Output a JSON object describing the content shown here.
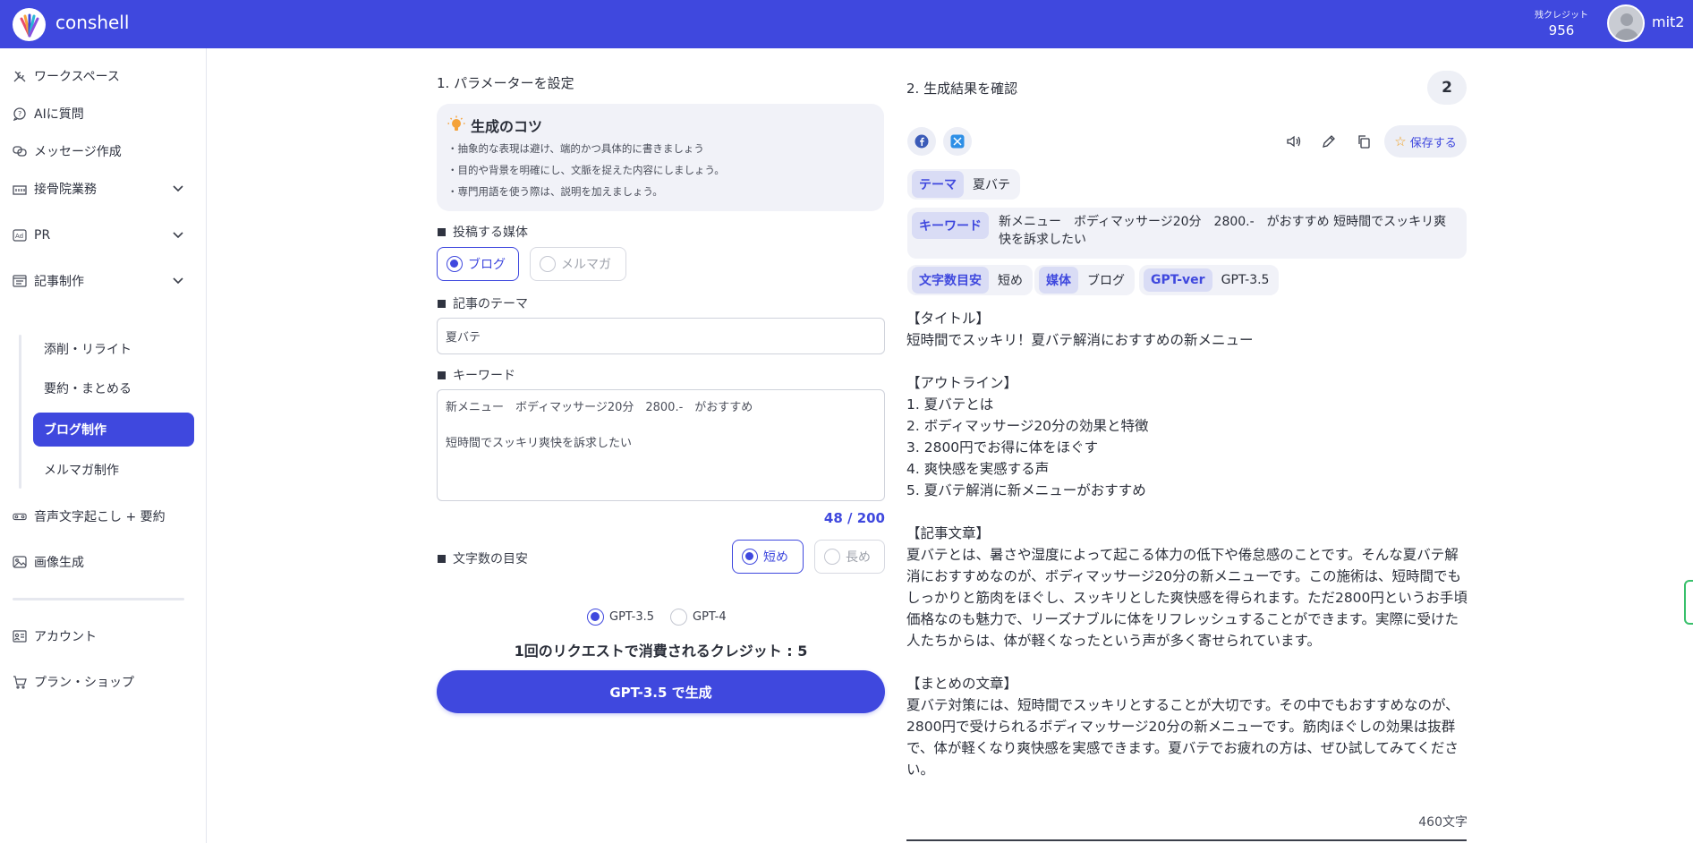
{
  "header": {
    "brand": "conshell",
    "credits_label": "残クレジット",
    "credits_value": "956",
    "username": "mit2"
  },
  "sidebar": {
    "items": [
      {
        "label": "ワークスペース",
        "icon": "tools-icon"
      },
      {
        "label": "AIに質問",
        "icon": "chat-question-icon"
      },
      {
        "label": "メッセージ作成",
        "icon": "chat-bubbles-icon"
      },
      {
        "label": "接骨院業務",
        "icon": "building-icon"
      },
      {
        "label": "PR",
        "icon": "ad-icon"
      },
      {
        "label": "記事制作",
        "icon": "article-icon"
      },
      {
        "label": "音声文字起こし + 要約",
        "icon": "audio-icon"
      },
      {
        "label": "画像生成",
        "icon": "image-icon"
      },
      {
        "label": "アカウント",
        "icon": "id-card-icon"
      },
      {
        "label": "プラン・ショップ",
        "icon": "cart-icon"
      }
    ],
    "sub_items": [
      "添削・リライト",
      "要約・まとめる",
      "ブログ制作",
      "メルマガ制作"
    ],
    "active_sub": "ブログ制作"
  },
  "params": {
    "title": "1. パラメーターを設定",
    "tips_title": "生成のコツ",
    "tips": [
      "・抽象的な表現は避け、端的かつ具体的に書きましょう",
      "・目的や背景を明確にし、文脈を捉えた内容にしましょう。",
      "・専門用語を使う際は、説明を加えましょう。"
    ],
    "media_label": "投稿する媒体",
    "media_options": [
      "ブログ",
      "メルマガ"
    ],
    "media_selected": "ブログ",
    "theme_label": "記事のテーマ",
    "theme_value": "夏バテ",
    "keyword_label": "キーワード",
    "keyword_value": "新メニュー　ボディマッサージ20分　2800.-　がおすすめ\n\n短時間でスッキリ爽快を訴求したい",
    "keyword_counter": "48 / 200",
    "length_label": "文字数の目安",
    "length_options": [
      "短め",
      "長め"
    ],
    "length_selected": "短め",
    "gpt_options": [
      "GPT-3.5",
      "GPT-4"
    ],
    "gpt_selected": "GPT-3.5",
    "credit_note": "1回のリクエストで消費されるクレジット : 5",
    "generate_label": "GPT-3.5 で生成"
  },
  "result": {
    "title": "2. 生成結果を確認",
    "count": "2",
    "save_label": "保存する",
    "chips": {
      "theme_tag": "テーマ",
      "theme_val": "夏バテ",
      "keyword_tag": "キーワード",
      "keyword_val": "新メニュー　ボディマッサージ20分　2800.-　がおすすめ 短時間でスッキリ爽快を訴求したい",
      "length_tag": "文字数目安",
      "length_val": "短め",
      "media_tag": "媒体",
      "media_val": "ブログ",
      "gpt_tag": "GPT-ver",
      "gpt_val": "GPT-3.5"
    },
    "body": "【タイトル】\n短時間でスッキリ！夏バテ解消におすすめの新メニュー\n\n【アウトライン】\n1. 夏バテとは\n2. ボディマッサージ20分の効果と特徴\n3. 2800円でお得に体をほぐす\n4. 爽快感を実感する声\n5. 夏バテ解消に新メニューがおすすめ\n\n【記事文章】\n夏バテとは、暑さや湿度によって起こる体力の低下や倦怠感のことです。そんな夏バテ解消におすすめなのが、ボディマッサージ20分の新メニューです。この施術は、短時間でもしっかりと筋肉をほぐし、スッキリとした爽快感を得られます。ただ2800円というお手頃価格なのも魅力で、リーズナブルに体をリフレッシュすることができます。実際に受けた人たちからは、体が軽くなったという声が多く寄せられています。\n\n【まとめの文章】\n夏バテ対策には、短時間でスッキリとすることが大切です。その中でもおすすめなのが、2800円で受けられるボディマッサージ20分の新メニューです。筋肉ほぐしの効果は抜群で、体が軽くなり爽快感を実感できます。夏バテでお疲れの方は、ぜひ試してみてください。",
    "char_count": "460文字"
  },
  "colors": {
    "accent": "#3f48de",
    "chip_bg": "#f1f2f8",
    "tag_bg": "#d9dcf5"
  }
}
